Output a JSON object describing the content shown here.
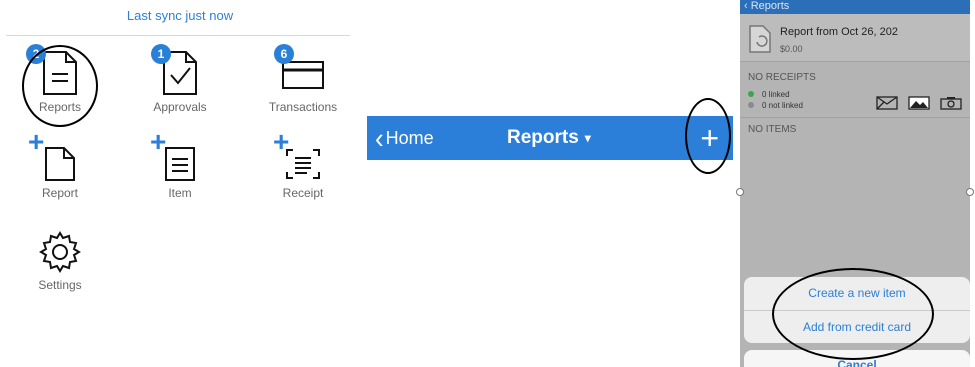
{
  "home": {
    "sync_text": "Last sync just now",
    "tiles": [
      {
        "label": "Reports",
        "icon": "reports-icon",
        "badge": "2"
      },
      {
        "label": "Approvals",
        "icon": "approvals-icon",
        "badge": "1"
      },
      {
        "label": "Transactions",
        "icon": "transactions-icon",
        "badge": "6"
      },
      {
        "label": "Report",
        "icon": "add-report-icon"
      },
      {
        "label": "Item",
        "icon": "add-item-icon"
      },
      {
        "label": "Receipt",
        "icon": "add-receipt-icon"
      },
      {
        "label": "Settings",
        "icon": "gear-icon"
      }
    ],
    "plus_glyph": "+"
  },
  "nav": {
    "back_label": "Home",
    "title": "Reports",
    "add_glyph": "+"
  },
  "report": {
    "back_label": "Reports",
    "title": "Report from Oct 26, 202",
    "amount": "$0.00",
    "no_receipts": "NO RECEIPTS",
    "linked": "0 linked",
    "not_linked": "0 not linked",
    "no_items": "NO ITEMS",
    "receipt_icons": [
      "envelope-icon",
      "photo-icon",
      "camera-icon"
    ]
  },
  "sheet": {
    "option_1": "Create a new item",
    "option_2": "Add from credit card",
    "cancel": "Cancel"
  },
  "colors": {
    "brand_blue": "#2c7fd8",
    "annotation": "#000000",
    "linked_dot": "#3aa64b",
    "not_linked_dot": "#8a8a8a"
  }
}
